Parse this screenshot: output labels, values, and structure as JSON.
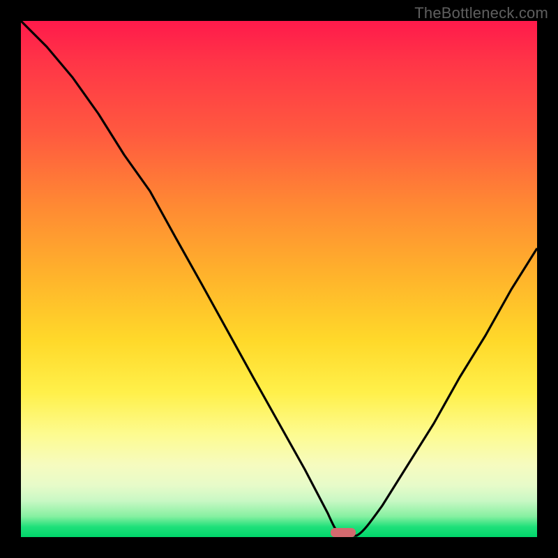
{
  "watermark": "TheBottleneck.com",
  "colors": {
    "frame": "#000000",
    "watermark": "#5f5f5f",
    "curve": "#000000",
    "marker": "#d46a6f",
    "gradient_top": "#ff1a4b",
    "gradient_bottom": "#00d66b"
  },
  "chart_data": {
    "type": "line",
    "title": "",
    "xlabel": "",
    "ylabel": "",
    "xlim": [
      0,
      100
    ],
    "ylim": [
      0,
      100
    ],
    "series": [
      {
        "name": "bottleneck-curve",
        "x": [
          0,
          5,
          10,
          15,
          20,
          25,
          30,
          35,
          40,
          45,
          50,
          55,
          60,
          62,
          65,
          70,
          75,
          80,
          85,
          90,
          95,
          100
        ],
        "values": [
          100,
          95,
          89,
          82,
          74,
          67,
          58,
          49,
          40,
          31,
          22,
          13,
          4,
          0,
          1,
          6,
          14,
          22,
          31,
          39,
          48,
          56
        ]
      }
    ],
    "marker": {
      "x_start": 60,
      "x_end": 65,
      "y": 0
    },
    "annotations": []
  }
}
